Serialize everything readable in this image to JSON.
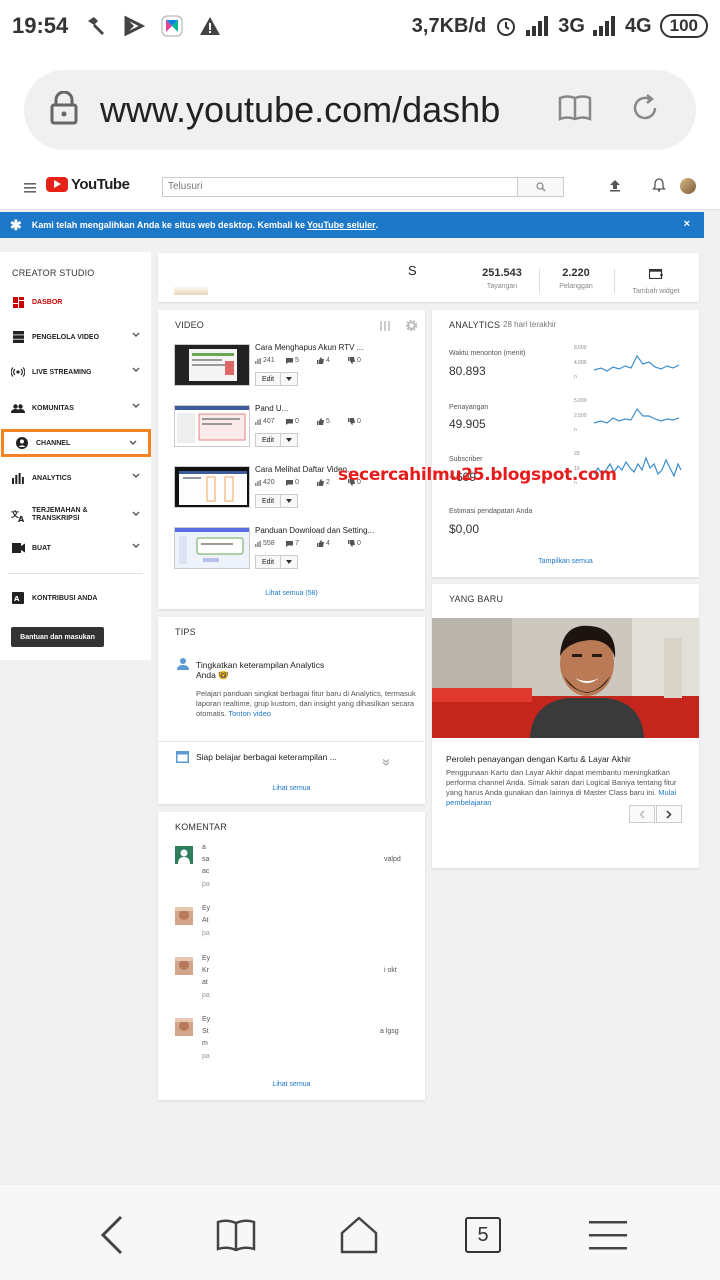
{
  "status_bar": {
    "time": "19:54",
    "speed": "3,7KB/d",
    "net1": "3G",
    "net2": "4G",
    "battery": "100"
  },
  "browser": {
    "url": "www.youtube.com/dashb",
    "tabs_count": "5"
  },
  "youtube": {
    "logo_text": "YouTube",
    "search_placeholder": "Telusuri",
    "brand_color": "#e62117"
  },
  "banner": {
    "text": "Kami telah mengalihkan Anda ke situs web desktop. Kembali ke",
    "link": "YouTube seluler",
    "suffix": ".",
    "close": "×",
    "color": "#1e78c8"
  },
  "sidebar": {
    "title": "CREATOR STUDIO",
    "items": [
      {
        "label": "DASBOR",
        "icon": "dashboard-icon"
      },
      {
        "label": "PENGELOLA VIDEO",
        "icon": "video-manager-icon"
      },
      {
        "label": "LIVE STREAMING",
        "icon": "live-icon"
      },
      {
        "label": "KOMUNITAS",
        "icon": "community-icon"
      },
      {
        "label": "CHANNEL",
        "icon": "channel-icon"
      },
      {
        "label": "ANALYTICS",
        "icon": "analytics-icon"
      },
      {
        "label": "TERJEMAHAN &",
        "label2": "TRANSKRIPSI",
        "icon": "translate-icon"
      },
      {
        "label": "BUAT",
        "icon": "create-icon"
      },
      {
        "label": "KONTRIBUSI ANDA",
        "icon": "contribute-icon"
      }
    ],
    "help_button": "Bantuan dan masukan",
    "highlight_color": "#f28322"
  },
  "channel": {
    "name": "S",
    "views_value": "251.543",
    "views_label": "Tayangan",
    "subs_value": "2.220",
    "subs_label": "Pelanggan",
    "widget_label": "Tambah widget"
  },
  "videos": {
    "title": "VIDEO",
    "rows": [
      {
        "title": "Cara Menghapus Akun RTV ...",
        "views": "241",
        "comments": "5",
        "likes": "4",
        "dislikes": "0"
      },
      {
        "title": "Pand                              U...",
        "views": "407",
        "comments": "0",
        "likes": "5",
        "dislikes": "0"
      },
      {
        "title": "Cara Melihat Daftar Video...",
        "views": "420",
        "comments": "0",
        "likes": "2",
        "dislikes": "0"
      },
      {
        "title": "Panduan Download dan Setting...",
        "views": "558",
        "comments": "7",
        "likes": "4",
        "dislikes": "0"
      }
    ],
    "edit_label": "Edit",
    "see_all": "Lihat semua (58)"
  },
  "analytics": {
    "title": "ANALYTICS",
    "period": "28 hari terakhir",
    "metrics": [
      {
        "label": "Waktu menonton (menit)",
        "value": "80.893",
        "ticks": [
          "8,000",
          "4,000",
          "0"
        ]
      },
      {
        "label": "Penayangan",
        "value": "49.905",
        "ticks": [
          "5,000",
          "2,500",
          "0"
        ]
      },
      {
        "label": "Subscriber",
        "value": "+609",
        "ticks": [
          "20",
          "10",
          "0"
        ]
      }
    ],
    "revenue_label": "Estimasi pendapatan Anda",
    "revenue_value": "$0,00",
    "show_all": "Tampilkan semua",
    "line_color": "#3d8fcf"
  },
  "tips": {
    "title": "TIPS",
    "tip1_title": "Tingkatkan keterampilan Analytics",
    "tip1_title2": "Anda 🤓",
    "tip1_body": "Pelajari panduan singkat berbagai fitur baru di Analytics, termasuk laporan realtime, grup kustom, dan insight yang dihasilkan secara otomatis.",
    "tip1_link": "Tonton video",
    "tip2_title": "Siap belajar berbagai keterampilan ...",
    "see_all": "Lihat semua"
  },
  "comments": {
    "title": "KOMENTAR",
    "items": [
      {
        "l1": "a",
        "l2": "sa",
        "l3": "ac",
        "l4": "pa",
        "right": "valpd"
      },
      {
        "l1": "Ey",
        "l2": "At",
        "l3": "pa",
        "right": ""
      },
      {
        "l1": "Ey",
        "l2": "Kr",
        "l3": "at",
        "l4": "pa",
        "right": "i okt"
      },
      {
        "l1": "Ey",
        "l2": "St",
        "l3": "m",
        "l4": "pa",
        "right": "a lgsg"
      }
    ],
    "see_all": "Lihat semua"
  },
  "whats_new": {
    "title": "YANG BARU",
    "heading": "Peroleh penayangan dengan Kartu & Layar Akhir",
    "body": "Penggunaan Kartu dan Layar Akhir dapat membantu meningkatkan performa channel Anda. Simak saran dari Logical Baniya tentang fitur yang harus Anda gunakan dan lainnya di Master Class baru ini.",
    "link": "Mulai pembelajaran"
  },
  "watermark": "secercahilmu25.blogspot.com"
}
